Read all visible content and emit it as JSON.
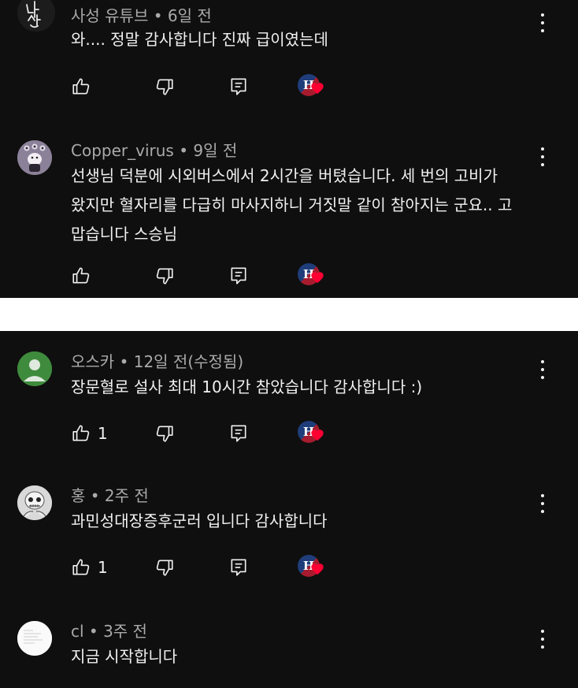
{
  "comments_top": [
    {
      "author": "사성 유튜브",
      "time": "6일 전",
      "text": [
        "와.... 정말 감사합니다 진짜 급이였는데"
      ],
      "likes": "",
      "avatar": "handwritten-avatar",
      "avatar_text": "나성"
    },
    {
      "author": "Copper_virus",
      "time": "9일 전",
      "text": [
        "선생님 덕분에 시외버스에서 2시간을 버텼습니다. 세 번의 고비가",
        "왔지만 혈자리를 다급히 마사지하니 거짓말 같이 참아지는 군요.. 고",
        "맙습니다 스승님"
      ],
      "likes": "",
      "avatar": "character-avatar"
    }
  ],
  "comments_bottom": [
    {
      "author": "오스카",
      "time": "12일 전(수정됨)",
      "text": [
        "장문혈로 설사 최대 10시간 참았습니다 감사합니다 :)"
      ],
      "likes": "1",
      "avatar": "default-user-avatar"
    },
    {
      "author": "홍",
      "time": "2주 전",
      "text": [
        "과민성대장증후군러 입니다 감사합니다"
      ],
      "likes": "1",
      "avatar": "skull-avatar"
    },
    {
      "author": "cl",
      "time": "3주 전",
      "text": [
        "지금 시작합니다"
      ],
      "likes": "",
      "avatar": "document-avatar"
    }
  ],
  "meta_separator": "•",
  "creator_badge_letter": "H",
  "colors": {
    "background": "#0f0f0f",
    "text_primary": "#f1f1f1",
    "text_secondary": "#aaaaaa",
    "heart": "#ff0033",
    "default_avatar": "#3f8b3d",
    "divider": "#ffffff"
  },
  "icons": [
    "like-icon",
    "dislike-icon",
    "reply-icon",
    "creator-heart-icon",
    "more-options-icon"
  ]
}
